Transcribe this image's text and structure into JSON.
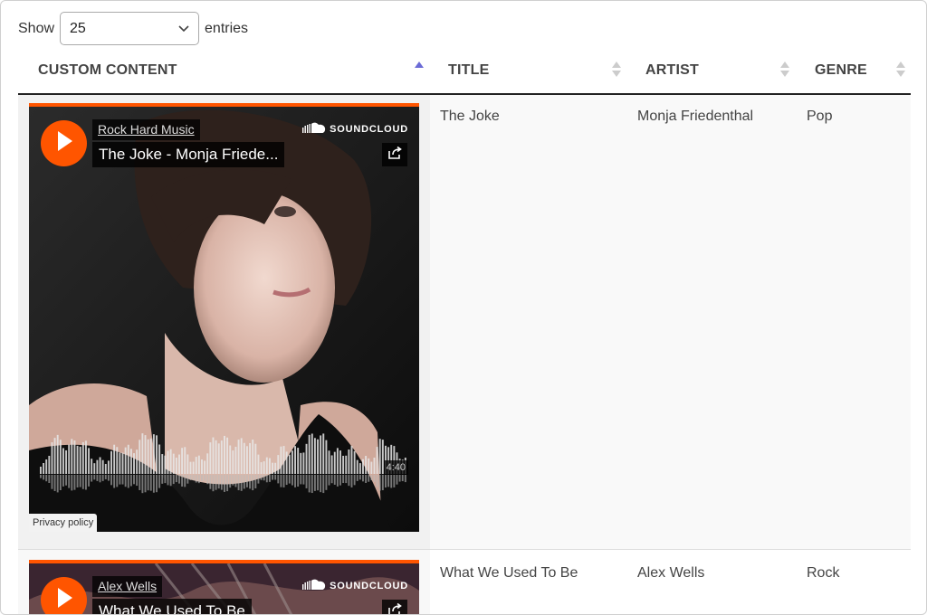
{
  "length_menu": {
    "prefix": "Show",
    "value": "25",
    "suffix": "entries"
  },
  "columns": [
    {
      "label": "CUSTOM CONTENT",
      "sort": "ascending"
    },
    {
      "label": "TITLE",
      "sort": "none"
    },
    {
      "label": "ARTIST",
      "sort": "none"
    },
    {
      "label": "GENRE",
      "sort": "none"
    }
  ],
  "rows": [
    {
      "player": {
        "uploader": "Rock Hard Music",
        "track_title": "The Joke - Monja Friede...",
        "brand": "SOUNDCLOUD",
        "duration": "4:40",
        "privacy": "Privacy policy"
      },
      "title": "The Joke",
      "artist": "Monja Friedenthal",
      "genre": "Pop"
    },
    {
      "player": {
        "uploader": "Alex Wells",
        "track_title": "What We Used To Be",
        "brand": "SOUNDCLOUD"
      },
      "title": "What We Used To Be",
      "artist": "Alex Wells",
      "genre": "Rock"
    }
  ],
  "colors": {
    "accent": "#ff5500",
    "sort_active": "#6b6bd6",
    "sort_inactive": "#cccccc"
  },
  "icons": {
    "play": "play-icon",
    "soundcloud": "soundcloud-icon",
    "share": "share-icon",
    "select": "chevron-down-icon",
    "sort_asc": "sort-ascending-icon",
    "sort_both": "sort-both-icon"
  }
}
